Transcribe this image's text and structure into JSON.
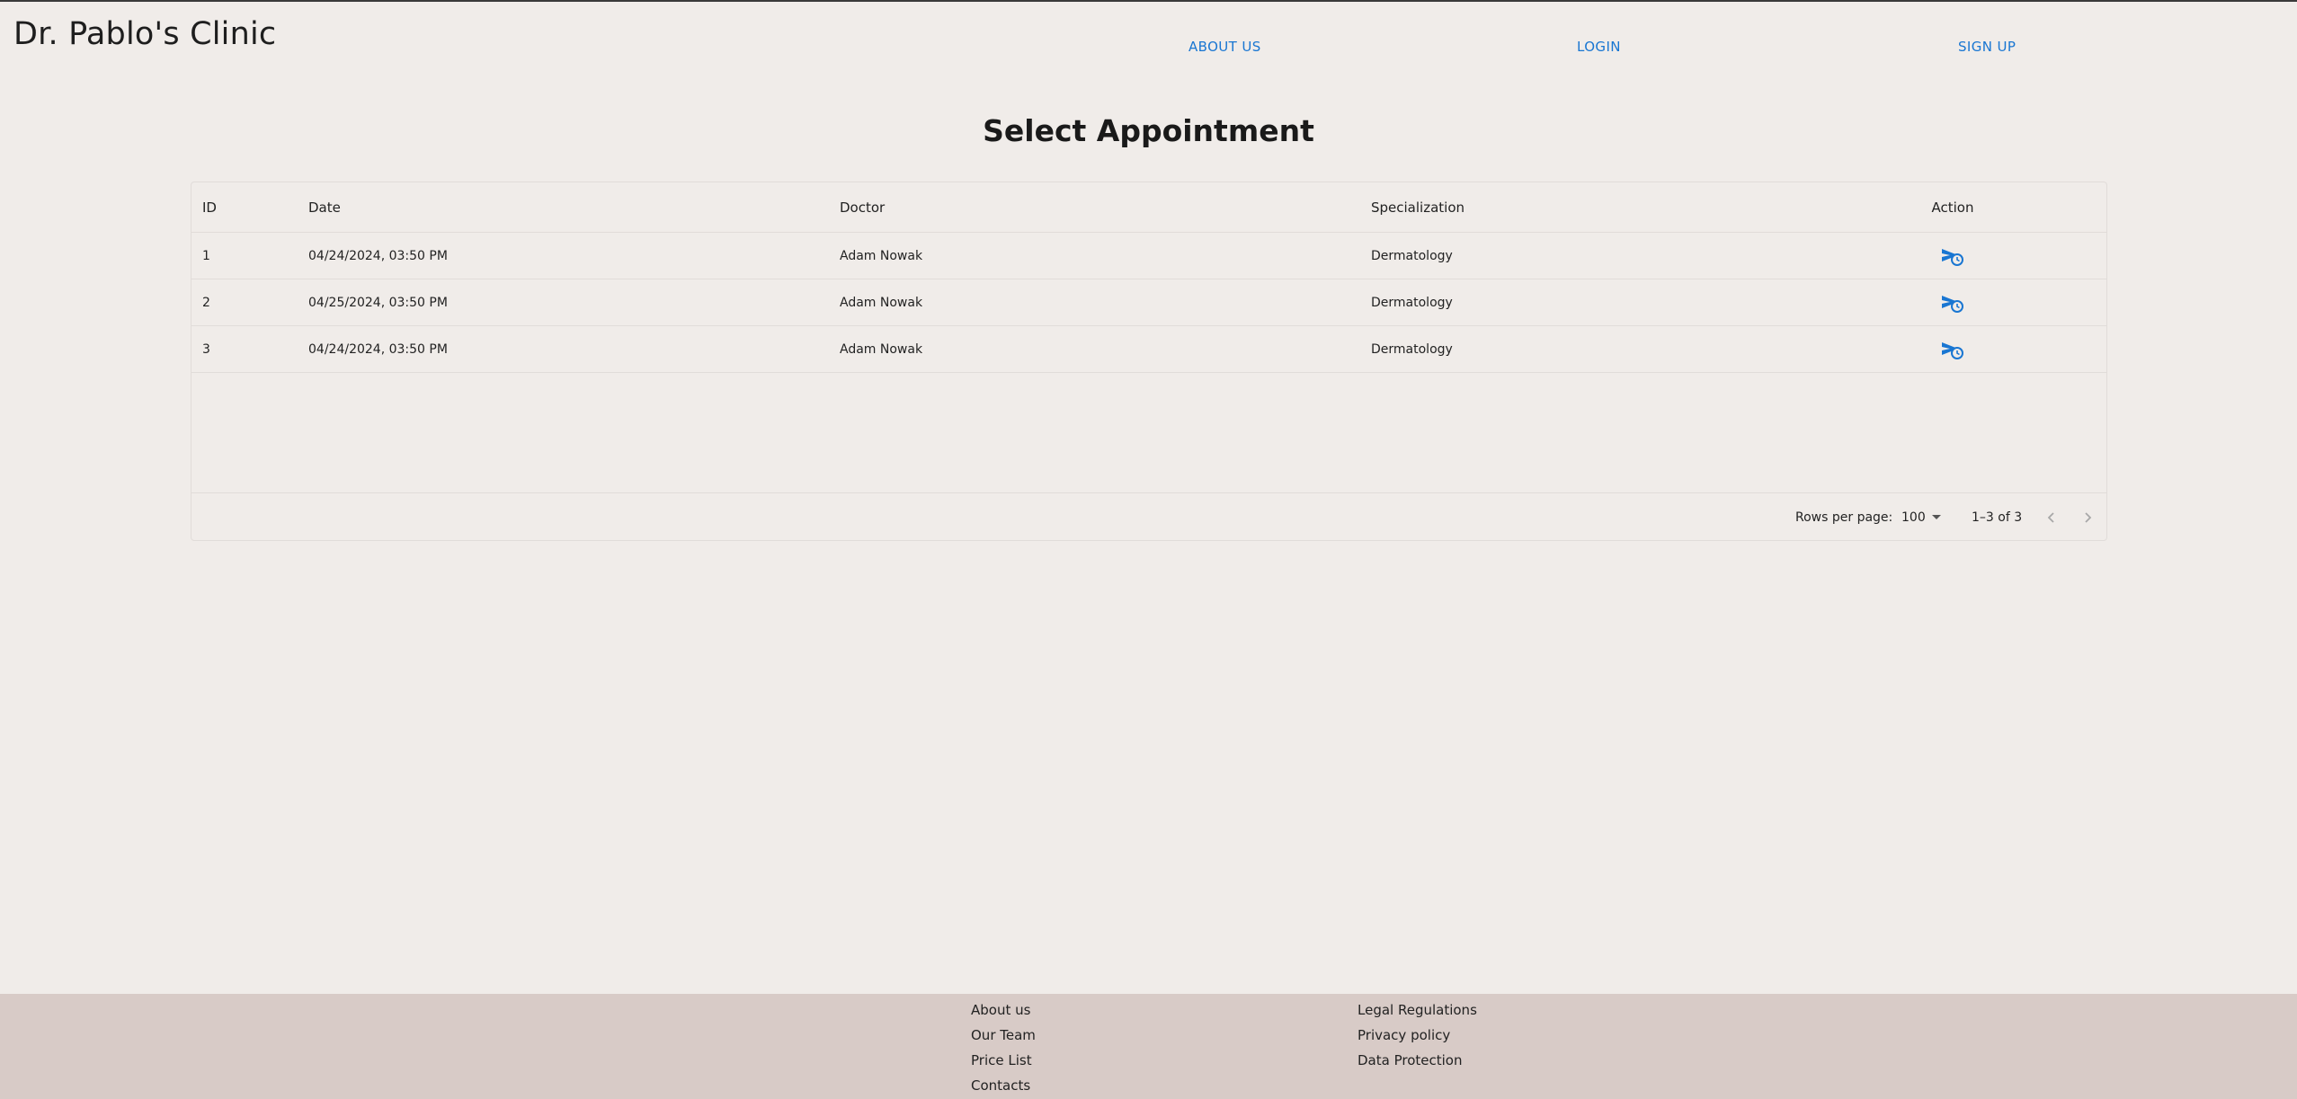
{
  "header": {
    "brand": "Dr. Pablo's Clinic",
    "nav": {
      "about": "ABOUT US",
      "login": "LOGIN",
      "signup": "SIGN UP"
    }
  },
  "main": {
    "title": "Select Appointment",
    "table": {
      "columns": [
        "ID",
        "Date",
        "Doctor",
        "Specialization",
        "Action"
      ],
      "rows": [
        {
          "id": "1",
          "date": "04/24/2024, 03:50 PM",
          "doctor": "Adam Nowak",
          "specialization": "Dermatology",
          "action_icon": "schedule-send-icon"
        },
        {
          "id": "2",
          "date": "04/25/2024, 03:50 PM",
          "doctor": "Adam Nowak",
          "specialization": "Dermatology",
          "action_icon": "schedule-send-icon"
        },
        {
          "id": "3",
          "date": "04/24/2024, 03:50 PM",
          "doctor": "Adam Nowak",
          "specialization": "Dermatology",
          "action_icon": "schedule-send-icon"
        }
      ],
      "pagination": {
        "rows_per_page_label": "Rows per page:",
        "rows_per_page_value": "100",
        "page_info": "1–3 of 3",
        "prev_icon": "chevron-left-icon",
        "next_icon": "chevron-right-icon"
      }
    }
  },
  "footer": {
    "col1": [
      "About us",
      "Our Team",
      "Price List",
      "Contacts"
    ],
    "col2": [
      "Legal Regulations",
      "Privacy policy",
      "Data Protection"
    ]
  },
  "colors": {
    "background": "#f0ece9",
    "footer": "#d8cbc7",
    "accent": "#1976d2"
  }
}
